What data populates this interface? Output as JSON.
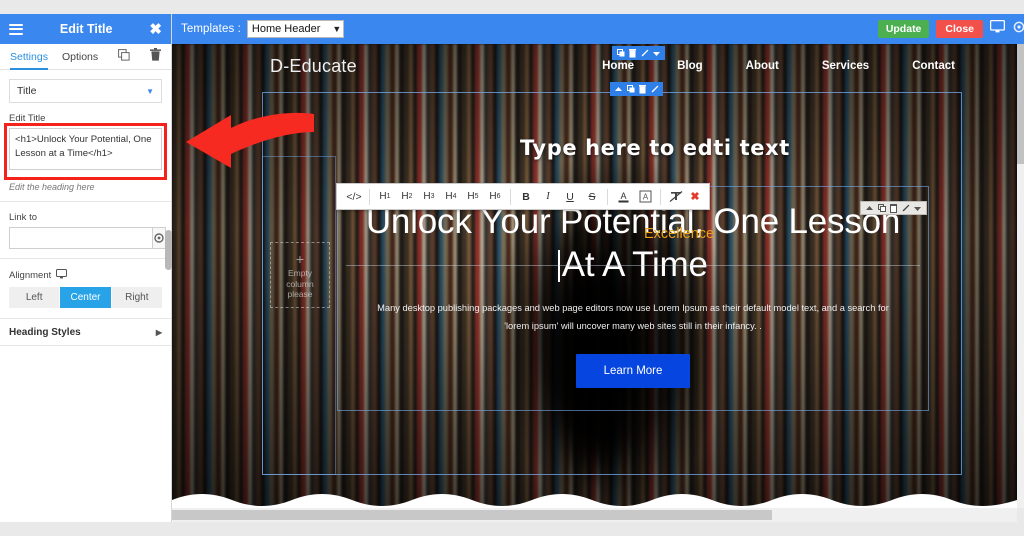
{
  "panel": {
    "title": "Edit Title",
    "menu_icon": "hamburger-icon",
    "close_icon": "close-icon",
    "tabs": [
      {
        "label": "Settings",
        "active": true
      },
      {
        "label": "Options",
        "active": false
      }
    ],
    "tab_tools": [
      {
        "icon": "duplicate-icon"
      },
      {
        "icon": "trash-icon"
      }
    ],
    "module_select": {
      "value": "Title",
      "caret": "▾"
    },
    "edit_title": {
      "label": "Edit Title",
      "value": "<h1>Unlock Your Potential, One Lesson at a Time</h1>",
      "hint": "Edit the heading here"
    },
    "link_to": {
      "label": "Link to",
      "value": "",
      "placeholder": "",
      "gear_icon": "gear-icon"
    },
    "alignment": {
      "label": "Alignment",
      "device_icon": "monitor-icon",
      "options": [
        "Left",
        "Center",
        "Right"
      ],
      "selected": "Center"
    },
    "heading_styles": {
      "label": "Heading Styles",
      "arrow": "▸"
    }
  },
  "topbar": {
    "templates_label": "Templates :",
    "template_value": "Home Header",
    "template_caret": "⌄",
    "update_label": "Update",
    "close_label": "Close",
    "monitor_icon": "monitor-icon",
    "gear_icon": "gear-icon"
  },
  "site": {
    "brand": "D-Educate",
    "nav": [
      "Home",
      "Blog",
      "About",
      "Services",
      "Contact"
    ],
    "hero": {
      "heading_line1": "Unlock Your Potential, One Lesson",
      "heading_line2": "At A Time",
      "paragraph_line1": "Many desktop publishing packages and web page editors now use Lorem Ipsum as their default model text, and a search for",
      "paragraph_line2": "'lorem ipsum' will uncover many web sites still in their infancy. .",
      "button_label": "Learn More"
    },
    "excellence_label": "Excellence",
    "empty_column": {
      "plus": "+",
      "line1": "Empty",
      "line2": "column",
      "line3": "please"
    }
  },
  "editor_toolbar": {
    "code_icon": "code-icon",
    "headings": [
      "H1",
      "H2",
      "H3",
      "H4",
      "H5",
      "H6"
    ],
    "bold": "B",
    "italic": "I",
    "underline": "U",
    "strikethrough": "S",
    "text_color_icon": "text-color-icon",
    "highlight_icon": "highlight-icon",
    "clear_format_icon": "clear-format-icon",
    "close_icon": "close-icon"
  },
  "widget_controls": {
    "group_a": [
      "duplicate-icon",
      "trash-icon",
      "pencil-icon",
      "caret-down-icon"
    ],
    "group_b": [
      "caret-up-icon",
      "duplicate-icon",
      "trash-icon",
      "pencil-icon"
    ],
    "group_c": [
      "caret-up-icon",
      "duplicate-icon",
      "trash-icon",
      "pencil-icon",
      "caret-down-icon"
    ]
  },
  "annotation": {
    "text": "Type here to edti text",
    "arrow": "red-arrow-left"
  },
  "colors": {
    "primary_blue": "#3b87f0",
    "accent_blue": "#29a3e8",
    "update_green": "#4caf50",
    "close_red": "#f2504b",
    "highlight_red": "#f5221b",
    "excellence_gold": "#e8a317",
    "cta_blue": "#0645e0"
  }
}
